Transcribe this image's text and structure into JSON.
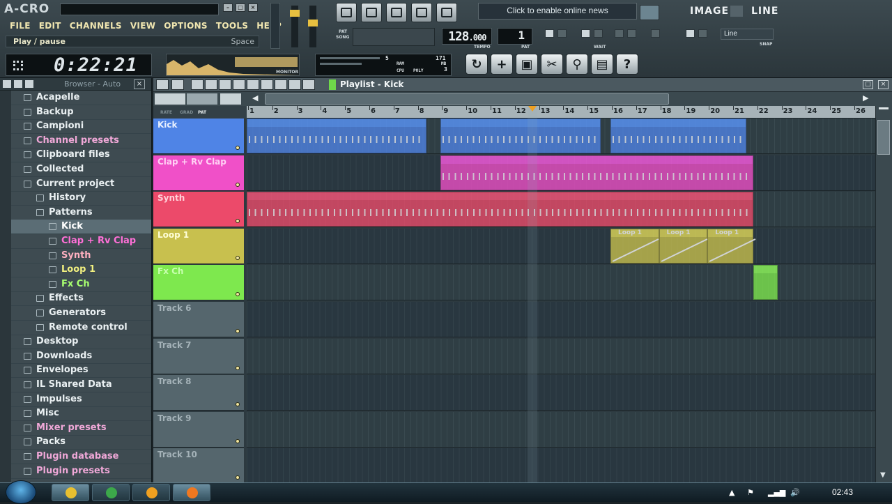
{
  "app": {
    "logo": "A-CRO"
  },
  "menu": [
    "FILE",
    "EDIT",
    "CHANNELS",
    "VIEW",
    "OPTIONS",
    "TOOLS",
    "HELP"
  ],
  "hint": {
    "label": "Play / pause",
    "shortcut": "Space"
  },
  "transport": {
    "time": "0:22:21",
    "tempo_main": "128",
    "tempo_dec": ".000",
    "tempo_label": "TEMPO",
    "pattern": "1",
    "pattern_label": "PAT",
    "pat_label": "PAT",
    "song_label": "SONG",
    "monitor_label": "MONITOR",
    "ram_label": "RAM",
    "cpu_label": "CPU",
    "poly_label": "POLY",
    "cpu_val1": "5",
    "cpu_val2": "171",
    "mb_label": "MB",
    "poly_val": "3",
    "wait_label": "WAIT",
    "snap_label": "SNAP",
    "snap_value": "Line"
  },
  "news": "Click to enable online news",
  "header_right": {
    "image": "IMAGE",
    "line": "LINE"
  },
  "browser": {
    "title": "Browser - Auto",
    "items": [
      {
        "label": "Acapelle",
        "level": 0,
        "color": "#eaf0f2"
      },
      {
        "label": "Backup",
        "level": 0,
        "color": "#eaf0f2"
      },
      {
        "label": "Campioni",
        "level": 0,
        "color": "#eaf0f2"
      },
      {
        "label": "Channel presets",
        "level": 0,
        "color": "#f0a8d8"
      },
      {
        "label": "Clipboard files",
        "level": 0,
        "color": "#eaf0f2"
      },
      {
        "label": "Collected",
        "level": 0,
        "color": "#eaf0f2"
      },
      {
        "label": "Current project",
        "level": 0,
        "color": "#eaf0f2"
      },
      {
        "label": "History",
        "level": 1,
        "color": "#eaf0f2"
      },
      {
        "label": "Patterns",
        "level": 1,
        "color": "#eaf0f2"
      },
      {
        "label": "Kick",
        "level": 2,
        "color": "#ffffff",
        "selected": true
      },
      {
        "label": "Clap + Rv Clap",
        "level": 2,
        "color": "#ff70d8"
      },
      {
        "label": "Synth",
        "level": 2,
        "color": "#ffb0c0"
      },
      {
        "label": "Loop 1",
        "level": 2,
        "color": "#f2f080"
      },
      {
        "label": "Fx Ch",
        "level": 2,
        "color": "#a8ff70"
      },
      {
        "label": "Effects",
        "level": 1,
        "color": "#eaf0f2"
      },
      {
        "label": "Generators",
        "level": 1,
        "color": "#eaf0f2"
      },
      {
        "label": "Remote control",
        "level": 1,
        "color": "#eaf0f2"
      },
      {
        "label": "Desktop",
        "level": 0,
        "color": "#eaf0f2"
      },
      {
        "label": "Downloads",
        "level": 0,
        "color": "#eaf0f2"
      },
      {
        "label": "Envelopes",
        "level": 0,
        "color": "#eaf0f2"
      },
      {
        "label": "IL Shared Data",
        "level": 0,
        "color": "#eaf0f2"
      },
      {
        "label": "Impulses",
        "level": 0,
        "color": "#eaf0f2"
      },
      {
        "label": "Misc",
        "level": 0,
        "color": "#eaf0f2"
      },
      {
        "label": "Mixer presets",
        "level": 0,
        "color": "#f0a8d8"
      },
      {
        "label": "Packs",
        "level": 0,
        "color": "#eaf0f2"
      },
      {
        "label": "Plugin database",
        "level": 0,
        "color": "#f0a8d8"
      },
      {
        "label": "Plugin presets",
        "level": 0,
        "color": "#f0a8d8"
      }
    ]
  },
  "playlist": {
    "title": "Playlist - Kick",
    "ruler": [
      "1",
      "2",
      "3",
      "4",
      "5",
      "6",
      "7",
      "8",
      "9",
      "10",
      "11",
      "12",
      "13",
      "14",
      "15",
      "16",
      "17",
      "18",
      "19",
      "20",
      "21",
      "22",
      "23",
      "24",
      "25",
      "26"
    ],
    "song_header": {
      "rate": "RATE",
      "grad": "GRAD",
      "pat": "PAT"
    },
    "tracks": [
      {
        "name": "Kick",
        "color": "#4f84e6",
        "text": "#e8f0ff"
      },
      {
        "name": "Clap + Rv Clap",
        "color": "#f050c8",
        "text": "#ffd0f4"
      },
      {
        "name": "Synth",
        "color": "#ec4a6a",
        "text": "#ffd0d8"
      },
      {
        "name": "Loop 1",
        "color": "#c8c04e",
        "text": "#ffffd8"
      },
      {
        "name": "Fx Ch",
        "color": "#7ee84e",
        "text": "#c8ffb0"
      },
      {
        "name": "Track 6",
        "color": "#55666d",
        "text": "#a4b2b8"
      },
      {
        "name": "Track 7",
        "color": "#55666d",
        "text": "#a4b2b8"
      },
      {
        "name": "Track 8",
        "color": "#55666d",
        "text": "#a4b2b8"
      },
      {
        "name": "Track 9",
        "color": "#55666d",
        "text": "#a4b2b8"
      },
      {
        "name": "Track 10",
        "color": "#55666d",
        "text": "#a4b2b8"
      }
    ],
    "clip_label_loop": "Loop 1"
  },
  "taskbar": {
    "time": "02:43"
  }
}
